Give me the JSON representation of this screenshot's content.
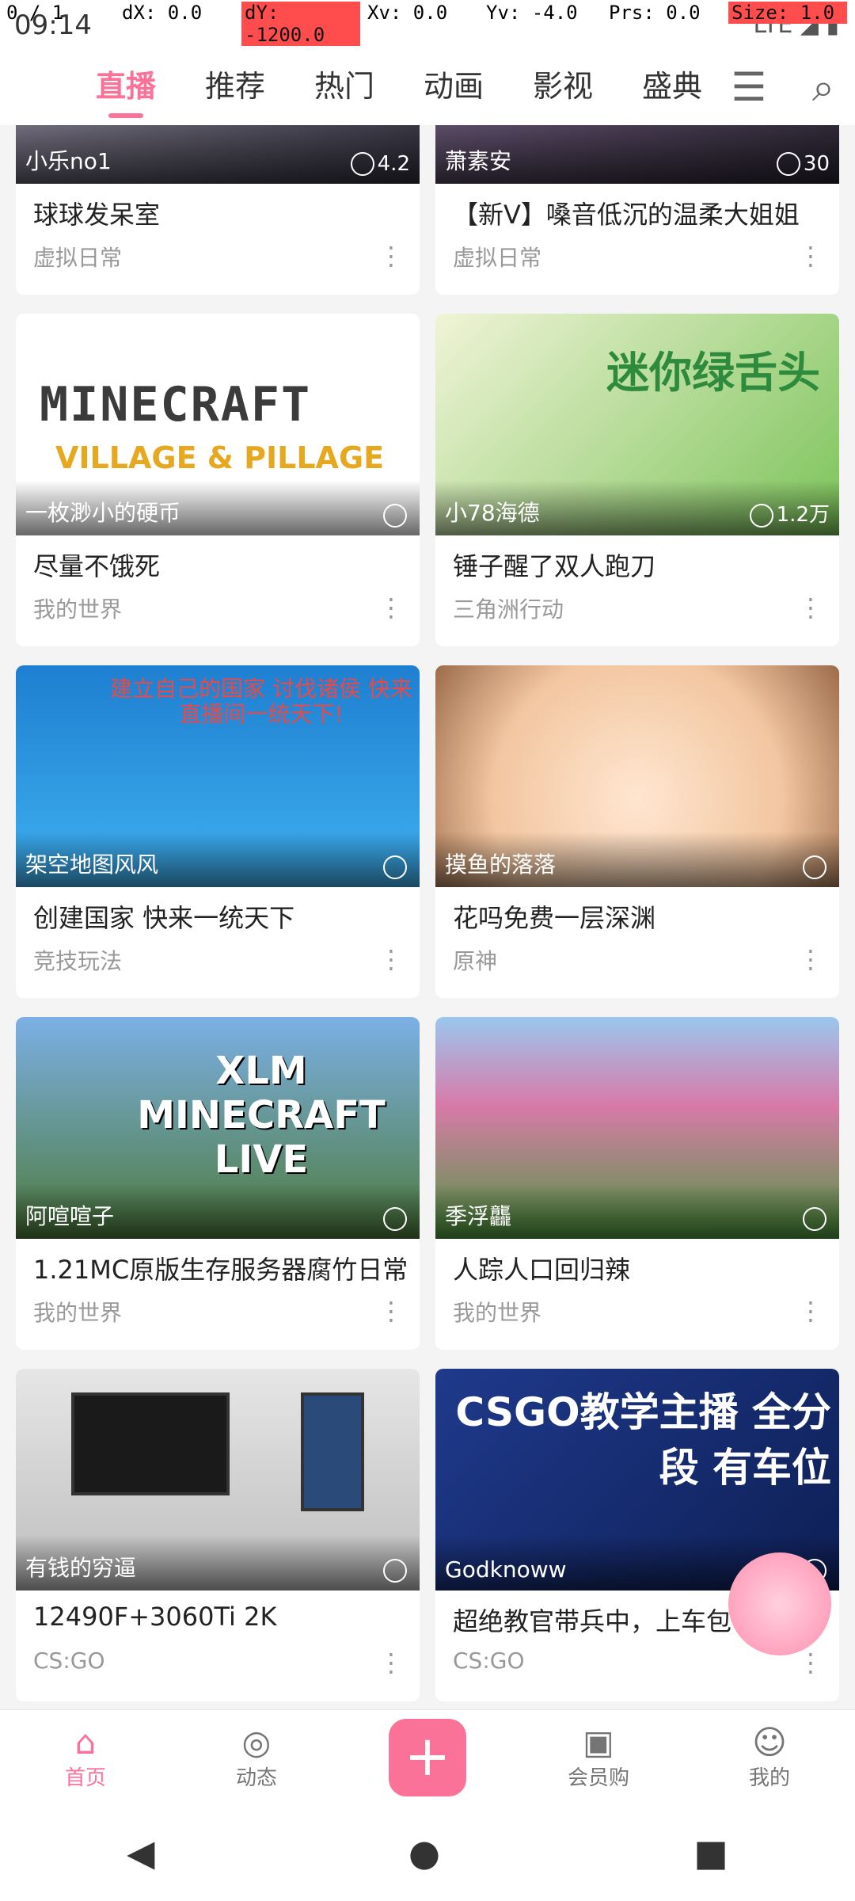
{
  "status_bar": {
    "time": "09:14",
    "icons": "LTE ◢ ▮",
    "debug": {
      "pointer": "0 / 1",
      "dx": "dX: 0.0",
      "dy": "dY: -1200.0",
      "xv": "Xv: 0.0",
      "yv": "Yv: -4.0",
      "prs": "Prs: 0.0",
      "size": "Size: 1.0"
    }
  },
  "tabs": [
    {
      "label": "直播",
      "active": true
    },
    {
      "label": "推荐"
    },
    {
      "label": "热门"
    },
    {
      "label": "动画"
    },
    {
      "label": "影视"
    },
    {
      "label": "盛典"
    }
  ],
  "tab_actions": {
    "menu_icon": "☰",
    "search_icon": "⌕"
  },
  "cards": [
    {
      "up": "小乐no1",
      "count": "4.2",
      "title": "球球发呆室",
      "category": "虚拟日常",
      "style": "t-dark",
      "first_row": true
    },
    {
      "up": "萧素安",
      "count": "30",
      "title": "【新V】嗓音低沉的温柔大姐姐",
      "category": "虚拟日常",
      "style": "t-dark2",
      "first_row": true
    },
    {
      "up": "一枚渺小的硬币",
      "count": "",
      "title": "尽量不饿死",
      "category": "我的世界",
      "style": "t-mc",
      "logo": "MINECRAFT",
      "sub": "VILLAGE & PILLAGE"
    },
    {
      "up": "小78海德",
      "count": "1.2万",
      "title": "锤子醒了双人跑刀",
      "category": "三角洲行动",
      "style": "t-ham",
      "thumb_text": "迷你绿舌头"
    },
    {
      "up": "架空地图风风",
      "count": "",
      "title": "创建国家 快来一统天下",
      "category": "竞技玩法",
      "style": "t-map",
      "thumb_text": "建立自己的国家 讨伐诸侯 快来直播间一统天下!"
    },
    {
      "up": "摸鱼的落落",
      "count": "",
      "title": "花吗免费一层深渊",
      "category": "原神",
      "style": "t-anime"
    },
    {
      "up": "阿喧喧子",
      "count": "",
      "title": "1.21MC原版生存服务器腐竹日常",
      "category": "我的世界",
      "style": "t-xlm",
      "thumb_text": "XLM MINECRAFT LIVE"
    },
    {
      "up": "季浮龘",
      "count": "",
      "title": "人踪人口回归辣",
      "category": "我的世界",
      "style": "t-blossom"
    },
    {
      "up": "有钱的穷逼",
      "count": "",
      "title": "12490F+3060Ti 2K",
      "category": "CS:GO",
      "style": "t-desk"
    },
    {
      "up": "Godknoww",
      "count": "",
      "title": "超绝教官带兵中，上车包",
      "category": "CS:GO",
      "style": "t-csgo",
      "thumb_text": "CSGO教学主播 全分段 有车位"
    }
  ],
  "bottom_nav": [
    {
      "label": "首页",
      "icon": "⌂",
      "active": true
    },
    {
      "label": "动态",
      "icon": "◎"
    },
    {
      "label": "",
      "icon": "+",
      "plus": true
    },
    {
      "label": "会员购",
      "icon": "▣"
    },
    {
      "label": "我的",
      "icon": "☺"
    }
  ],
  "system_nav": {
    "back": "◀",
    "home": "●",
    "recents": "■"
  },
  "colors": {
    "accent": "#fb7299",
    "background": "#f4f4f4"
  }
}
